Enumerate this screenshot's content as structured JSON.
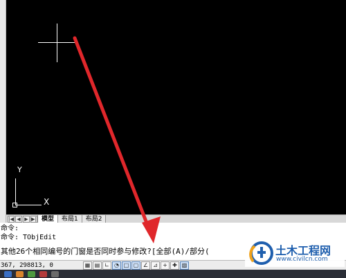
{
  "layout_tabs": {
    "model": "模型",
    "layout1": "布局1",
    "layout2": "布局2"
  },
  "ucs": {
    "y_label": "Y",
    "x_label": "X"
  },
  "command": {
    "line1": "命令:",
    "line2": "命令: TObjEdit",
    "prompt": "其他26个相同编号的门窗是否同时参与修改?[全部(A)/部分("
  },
  "status": {
    "coordinates": "367, 298813, 0"
  },
  "watermark": {
    "title": "土木工程网",
    "url": "www.civilcn.com"
  },
  "colors": {
    "canvas_bg": "#000000",
    "arrow": "#e0272b",
    "watermark_blue": "#1f5fae"
  }
}
